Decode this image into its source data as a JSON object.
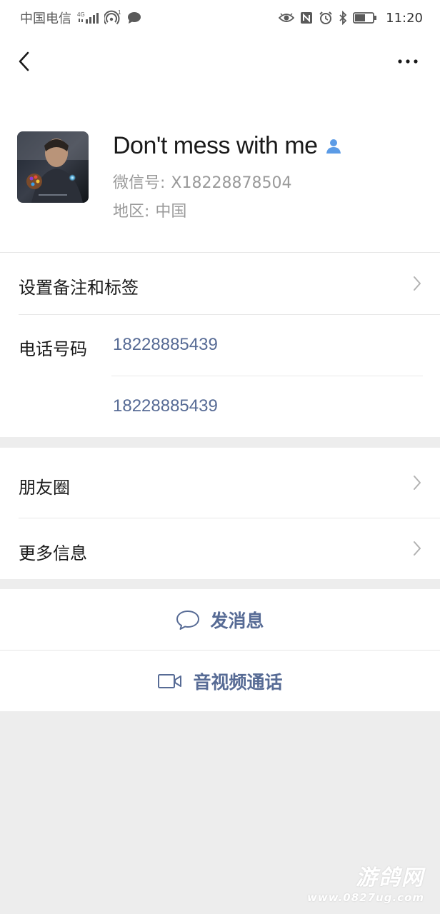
{
  "status_bar": {
    "carrier": "中国电信",
    "network": "4G",
    "notification_count": "1",
    "time": "11:20"
  },
  "header": {
    "back_icon": "chevron-left-icon",
    "more_icon": "more-dots-icon"
  },
  "profile": {
    "name": "Don't mess with me",
    "wechat_id_label": "微信号:",
    "wechat_id": "X18228878504",
    "region_label": "地区:",
    "region": "中国"
  },
  "info": {
    "remark_label": "设置备注和标签",
    "phone_label": "电话号码",
    "phones": [
      "18228885439",
      "18228885439"
    ]
  },
  "moments": {
    "moments_label": "朋友圈",
    "more_info_label": "更多信息"
  },
  "actions": {
    "message_label": "发消息",
    "call_label": "音视频通话"
  },
  "watermark": {
    "logo": "游鸽网",
    "url": "www.0827ug.com"
  },
  "colors": {
    "link": "#576b95",
    "background": "#ededed",
    "card": "#ffffff",
    "contact_icon": "#5b9be6"
  }
}
